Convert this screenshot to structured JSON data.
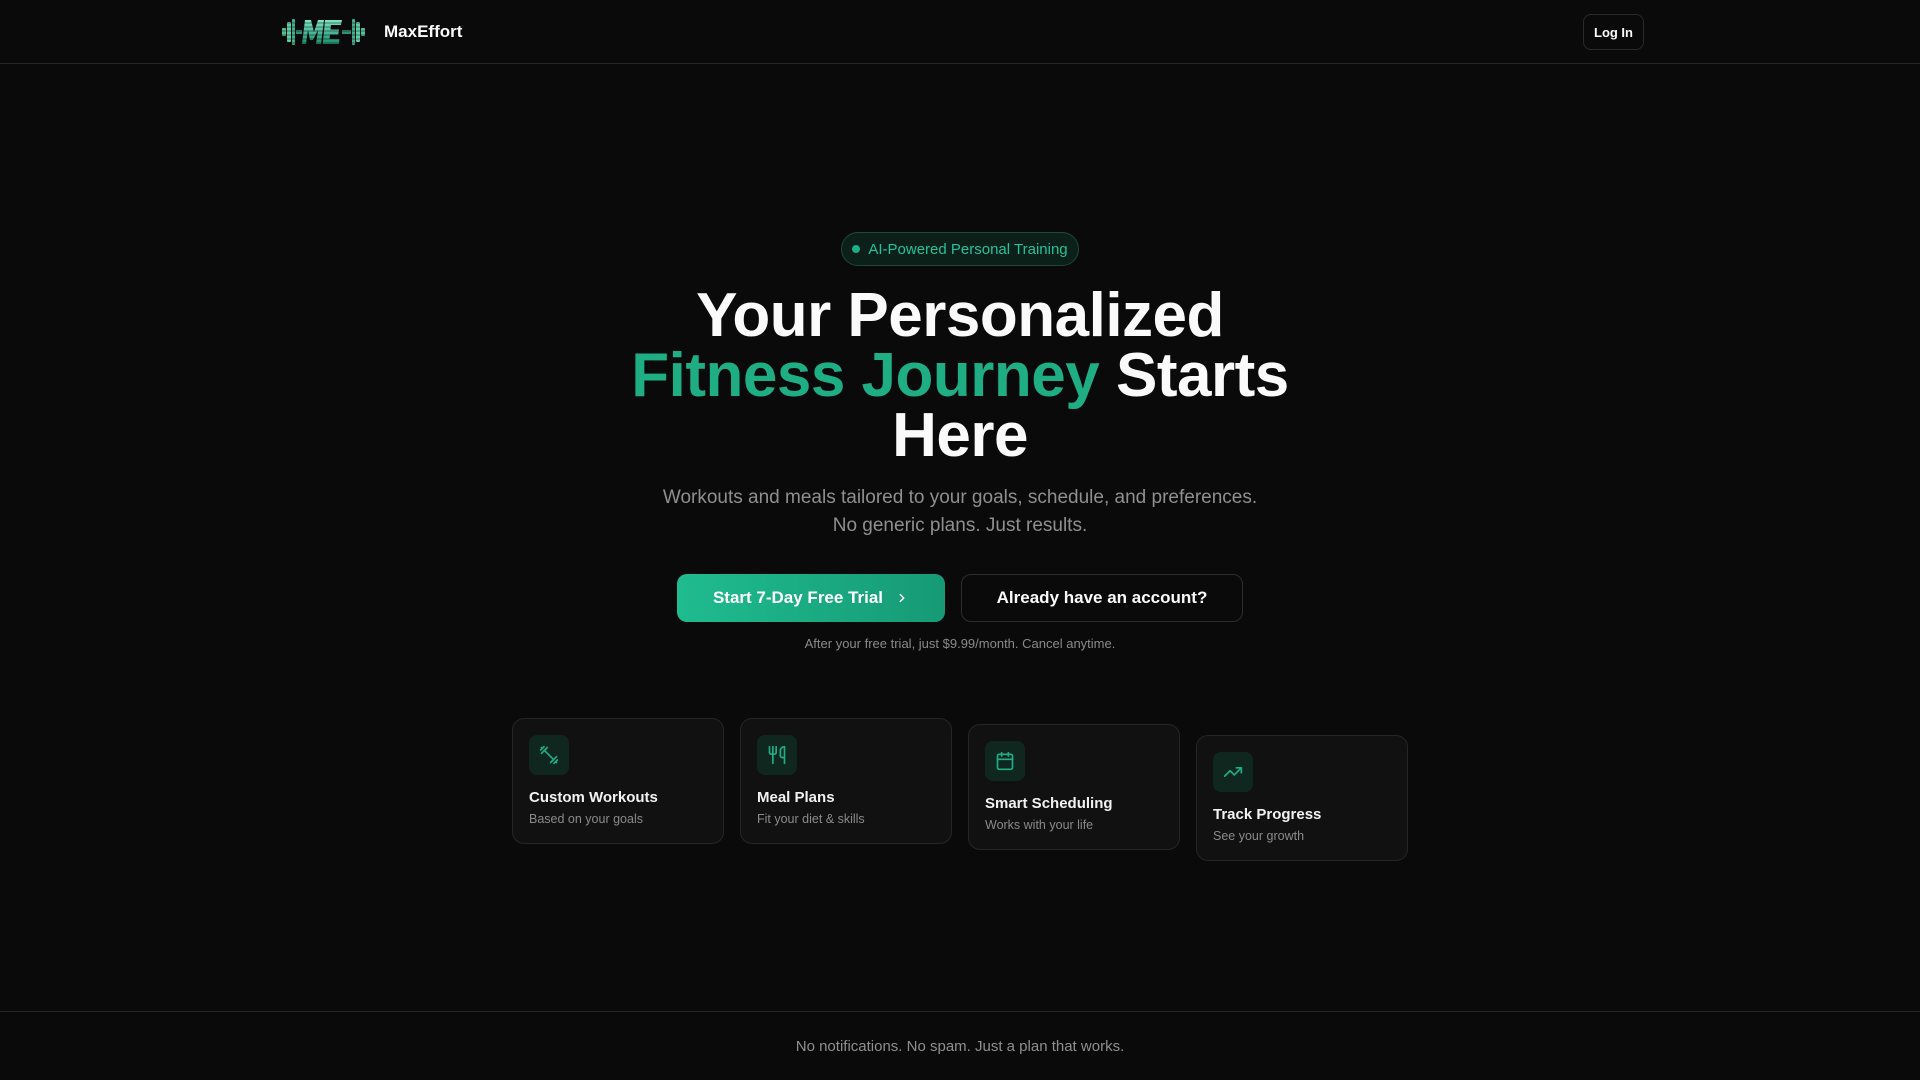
{
  "header": {
    "brand_name": "MaxEffort",
    "login_label": "Log In"
  },
  "hero": {
    "badge": "AI-Powered Personal Training",
    "headline_line1": "Your Personalized",
    "headline_accent": "Fitness Journey",
    "headline_rest": " Starts",
    "headline_line3": "Here",
    "subtitle": "Workouts and meals tailored to your goals, schedule, and preferences. No generic plans. Just results.",
    "cta_primary": "Start 7-Day Free Trial",
    "cta_secondary": "Already have an account?",
    "trial_note": "After your free trial, just $9.99/month. Cancel anytime."
  },
  "features": [
    {
      "title": "Custom Workouts",
      "subtitle": "Based on your goals",
      "icon": "dumbbell-icon"
    },
    {
      "title": "Meal Plans",
      "subtitle": "Fit your diet & skills",
      "icon": "utensils-icon"
    },
    {
      "title": "Smart Scheduling",
      "subtitle": "Works with your life",
      "icon": "calendar-icon"
    },
    {
      "title": "Track Progress",
      "subtitle": "See your growth",
      "icon": "trending-up-icon"
    }
  ],
  "footer": {
    "text": "No notifications. No spam. Just a plan that works."
  },
  "colors": {
    "background": "#0a0a0a",
    "accent": "#1fae84",
    "border": "#262626",
    "muted_text": "#8f8f8f"
  }
}
